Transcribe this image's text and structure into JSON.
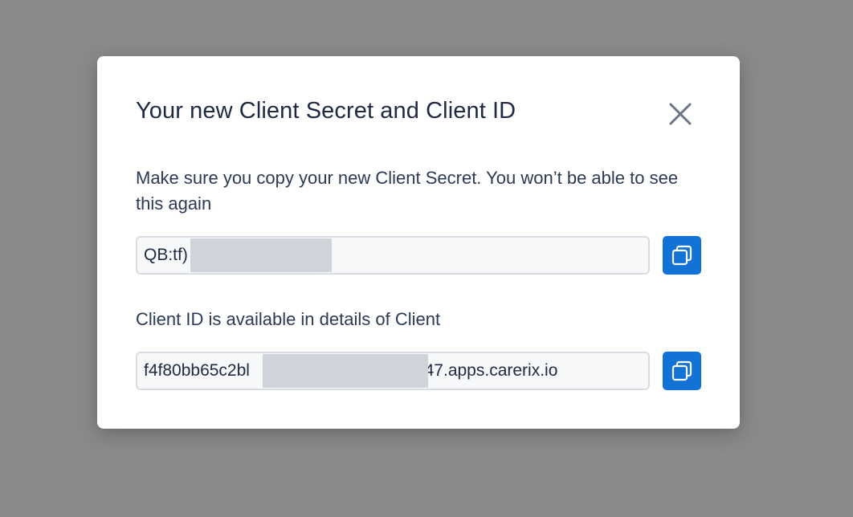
{
  "dialog": {
    "title": "Your new Client Secret and Client ID",
    "close_icon": "close-icon",
    "description": "Make sure you copy your new Client Secret. You won’t be able to see this again",
    "client_secret": {
      "value": "QB:tf)",
      "copy_icon": "copy-icon"
    },
    "client_id_label": "Client ID is available in details of Client",
    "client_id": {
      "value_start": "f4f80bb65c2bl",
      "value_end": "b47.apps.carerix.io",
      "copy_icon": "copy-icon"
    }
  },
  "colors": {
    "backdrop": "#8a8a8a",
    "title": "#1e2a44",
    "accent": "#1372d6",
    "field_border": "#d9dde3"
  }
}
